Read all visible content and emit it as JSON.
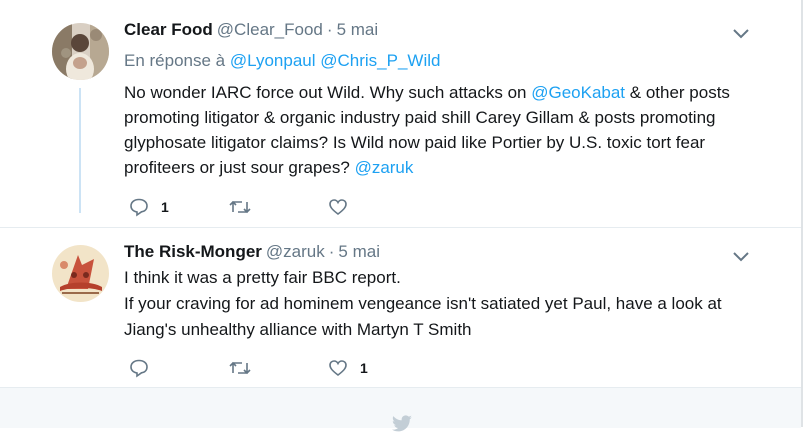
{
  "tweets": [
    {
      "name": "Clear Food",
      "handle": "@Clear_Food",
      "dot": "·",
      "time": "5 mai",
      "reply_prefix": "En réponse à",
      "reply_to": [
        "@Lyonpaul",
        "@Chris_P_Wild"
      ],
      "text_lines": [
        [
          "No wonder IARC force out Wild. Why such attacks on ",
          "@GeoKabat",
          " & other posts"
        ],
        [
          "promoting litigator & organic industry paid shill Carey Gillam & posts promoting"
        ],
        [
          "glyphosate litigator claims?  Is Wild now paid like Portier by U.S. toxic tort fear"
        ],
        [
          "profiteers or just sour grapes? ",
          "@zaruk"
        ]
      ],
      "reply_count": "1",
      "retweet_count": "",
      "like_count": ""
    },
    {
      "name": "The Risk-Monger",
      "handle": "@zaruk",
      "dot": "·",
      "time": "5 mai",
      "text_lines": [
        "I think it was a pretty fair BBC report.",
        "If your craving for ad hominem vengeance isn't satiated yet Paul, have a look at",
        "Jiang's unhealthy alliance with Martyn T Smith"
      ],
      "reply_count": "",
      "retweet_count": "",
      "like_count": "1"
    }
  ],
  "icons": {
    "reply": "reply-icon",
    "retweet": "retweet-icon",
    "like": "heart-icon",
    "menu": "chevron-down-icon",
    "footer": "twitter-bird-icon"
  },
  "colors": {
    "link": "#1da1f2",
    "muted": "#657786",
    "text": "#14171a",
    "thread_line": "#cce3f5",
    "footer_bg": "#f5f8fa"
  }
}
